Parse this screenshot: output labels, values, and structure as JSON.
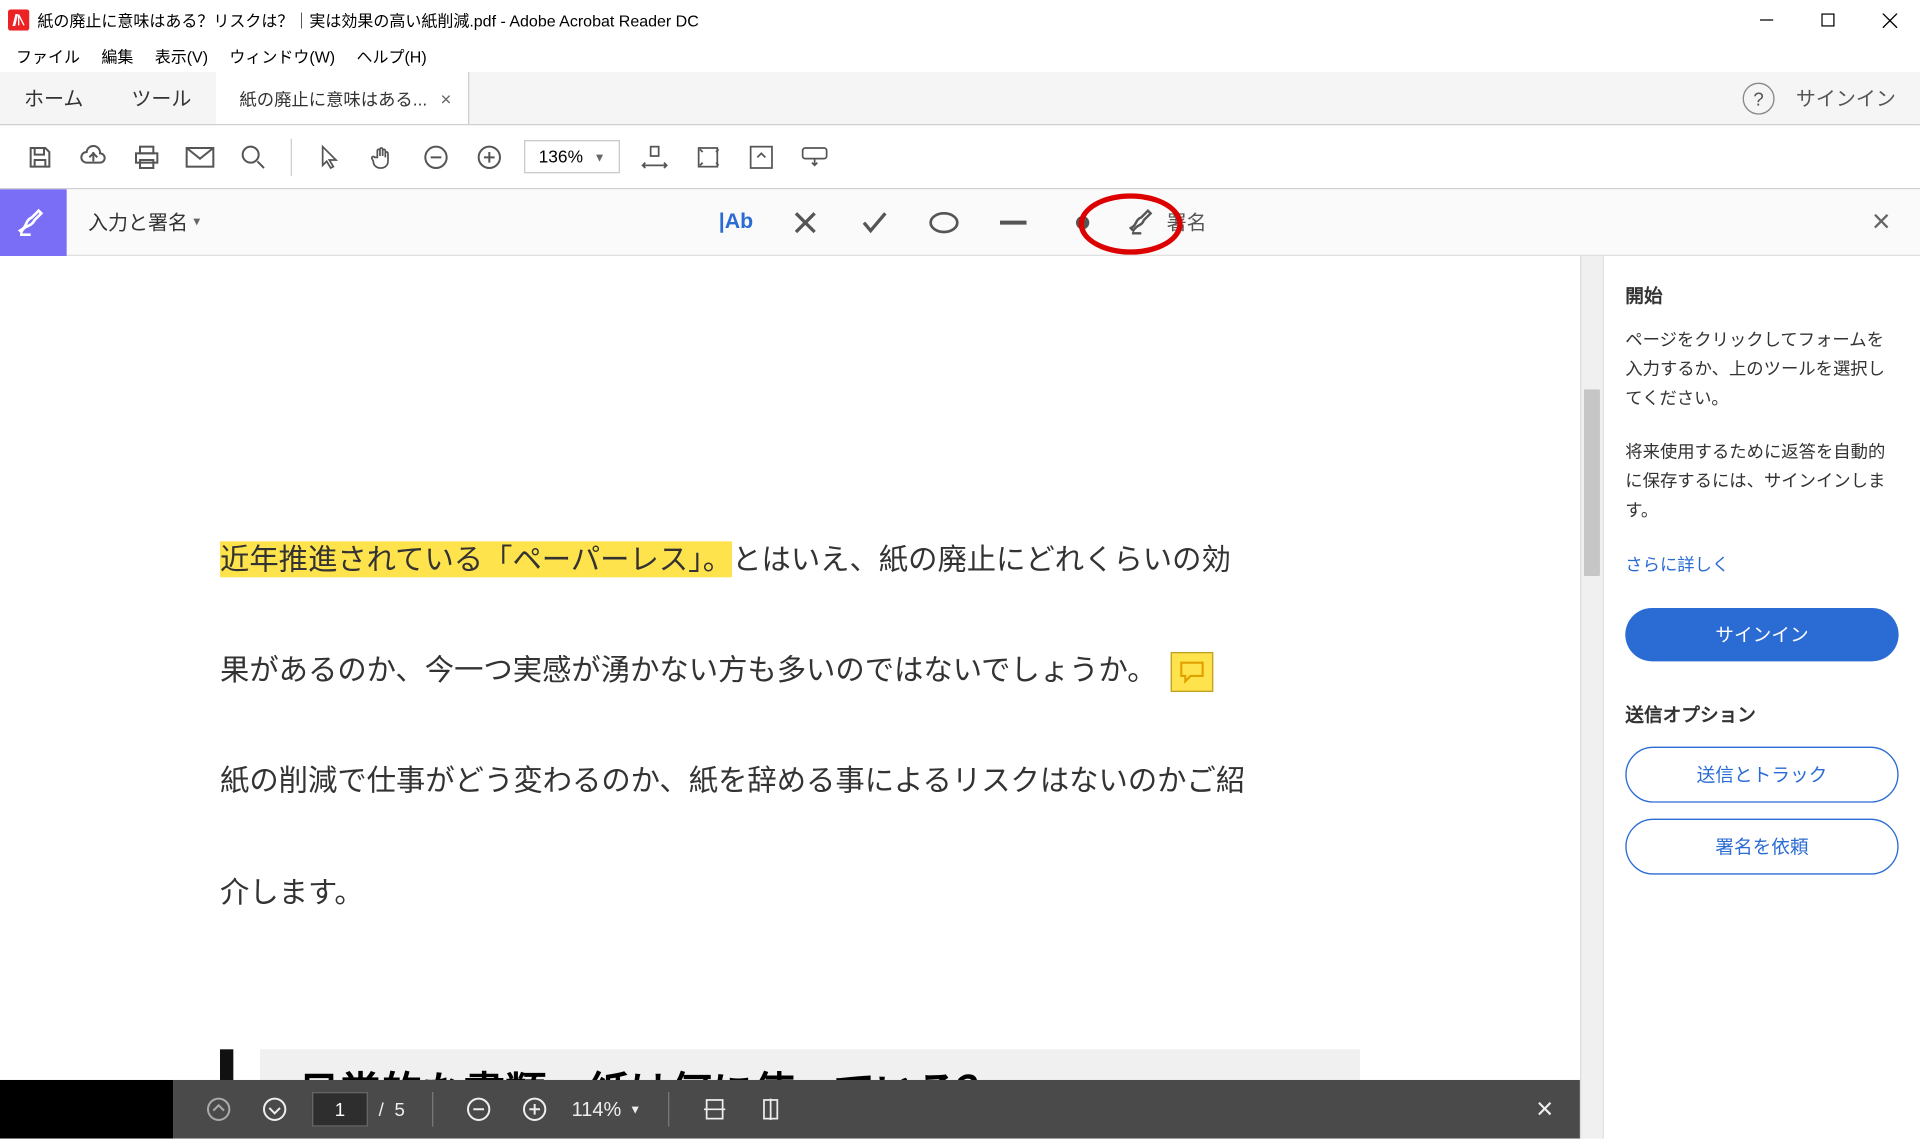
{
  "window": {
    "title": "紙の廃止に意味はある？リスクは？｜実は効果の高い紙削減.pdf - Adobe Acrobat Reader DC"
  },
  "menu": {
    "file": "ファイル",
    "edit": "編集",
    "view": "表示(V)",
    "window": "ウィンドウ(W)",
    "help": "ヘルプ(H)"
  },
  "tabs": {
    "home": "ホーム",
    "tools": "ツール",
    "doc": "紙の廃止に意味はある..."
  },
  "header": {
    "signin": "サインイン"
  },
  "toolbar": {
    "zoom": "136%"
  },
  "fillsign": {
    "label": "入力と署名",
    "ab": "|Ab",
    "sign": "署名"
  },
  "document": {
    "p1_hl": "近年推進されている「ペーパーレス」。",
    "p1_rest": "とはいえ、紙の廃止にどれくらいの効",
    "p2": "果があるのか、今一つ実感が湧かない方も多いのではないでしょうか。",
    "p3": "紙の削減で仕事がどう変わるのか、紙を辞める事によるリスクはないのかご紹",
    "p4": "介します。",
    "heading": "■日常的な書類。紙は何に使っている？"
  },
  "right_panel": {
    "start_title": "開始",
    "start_body": "ページをクリックしてフォームを入力するか、上のツールを選択してください。",
    "save_body": "将来使用するために返答を自動的に保存するには、サインインします。",
    "learn_more": "さらに詳しく",
    "signin_btn": "サインイン",
    "send_options": "送信オプション",
    "send_track": "送信とトラック",
    "request_sign": "署名を依頼"
  },
  "bottom_bar": {
    "page_current": "1",
    "page_sep": "/",
    "page_total": "5",
    "zoom": "114%"
  }
}
